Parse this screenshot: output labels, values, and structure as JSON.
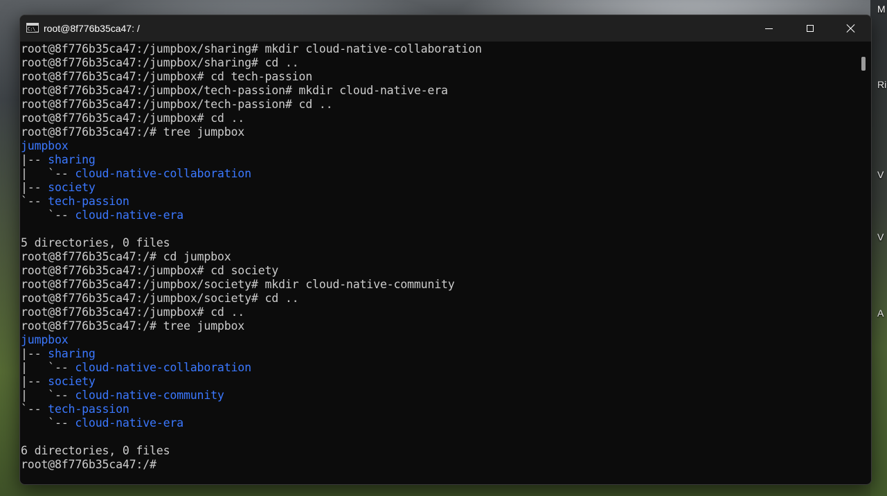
{
  "window": {
    "title": "root@8f776b35ca47: /",
    "icon_label": "C:\\_"
  },
  "controls": {
    "minimize": "minimize",
    "maximize": "maximize",
    "close": "close"
  },
  "desktop_labels": [
    "M",
    "Ri",
    "V",
    "V",
    "A"
  ],
  "terminal": {
    "lines": [
      {
        "text": "root@8f776b35ca47:/jumpbox/sharing# mkdir cloud-native-collaboration"
      },
      {
        "text": "root@8f776b35ca47:/jumpbox/sharing# cd .."
      },
      {
        "text": "root@8f776b35ca47:/jumpbox# cd tech-passion"
      },
      {
        "text": "root@8f776b35ca47:/jumpbox/tech-passion# mkdir cloud-native-era"
      },
      {
        "text": "root@8f776b35ca47:/jumpbox/tech-passion# cd .."
      },
      {
        "text": "root@8f776b35ca47:/jumpbox# cd .."
      },
      {
        "text": "root@8f776b35ca47:/# tree jumpbox"
      },
      {
        "prefix": "",
        "dir": "jumpbox"
      },
      {
        "prefix": "|-- ",
        "dir": "sharing"
      },
      {
        "prefix": "|   `-- ",
        "dir": "cloud-native-collaboration"
      },
      {
        "prefix": "|-- ",
        "dir": "society"
      },
      {
        "prefix": "`-- ",
        "dir": "tech-passion"
      },
      {
        "prefix": "    `-- ",
        "dir": "cloud-native-era"
      },
      {
        "text": ""
      },
      {
        "text": "5 directories, 0 files"
      },
      {
        "text": "root@8f776b35ca47:/# cd jumpbox"
      },
      {
        "text": "root@8f776b35ca47:/jumpbox# cd society"
      },
      {
        "text": "root@8f776b35ca47:/jumpbox/society# mkdir cloud-native-community"
      },
      {
        "text": "root@8f776b35ca47:/jumpbox/society# cd .."
      },
      {
        "text": "root@8f776b35ca47:/jumpbox# cd .."
      },
      {
        "text": "root@8f776b35ca47:/# tree jumpbox"
      },
      {
        "prefix": "",
        "dir": "jumpbox"
      },
      {
        "prefix": "|-- ",
        "dir": "sharing"
      },
      {
        "prefix": "|   `-- ",
        "dir": "cloud-native-collaboration"
      },
      {
        "prefix": "|-- ",
        "dir": "society"
      },
      {
        "prefix": "|   `-- ",
        "dir": "cloud-native-community"
      },
      {
        "prefix": "`-- ",
        "dir": "tech-passion"
      },
      {
        "prefix": "    `-- ",
        "dir": "cloud-native-era"
      },
      {
        "text": ""
      },
      {
        "text": "6 directories, 0 files"
      },
      {
        "text": "root@8f776b35ca47:/# "
      }
    ]
  },
  "colors": {
    "terminal_bg": "#0c0c0c",
    "terminal_fg": "#cccccc",
    "directory_blue": "#3b78ff",
    "titlebar_bg": "#202020"
  }
}
